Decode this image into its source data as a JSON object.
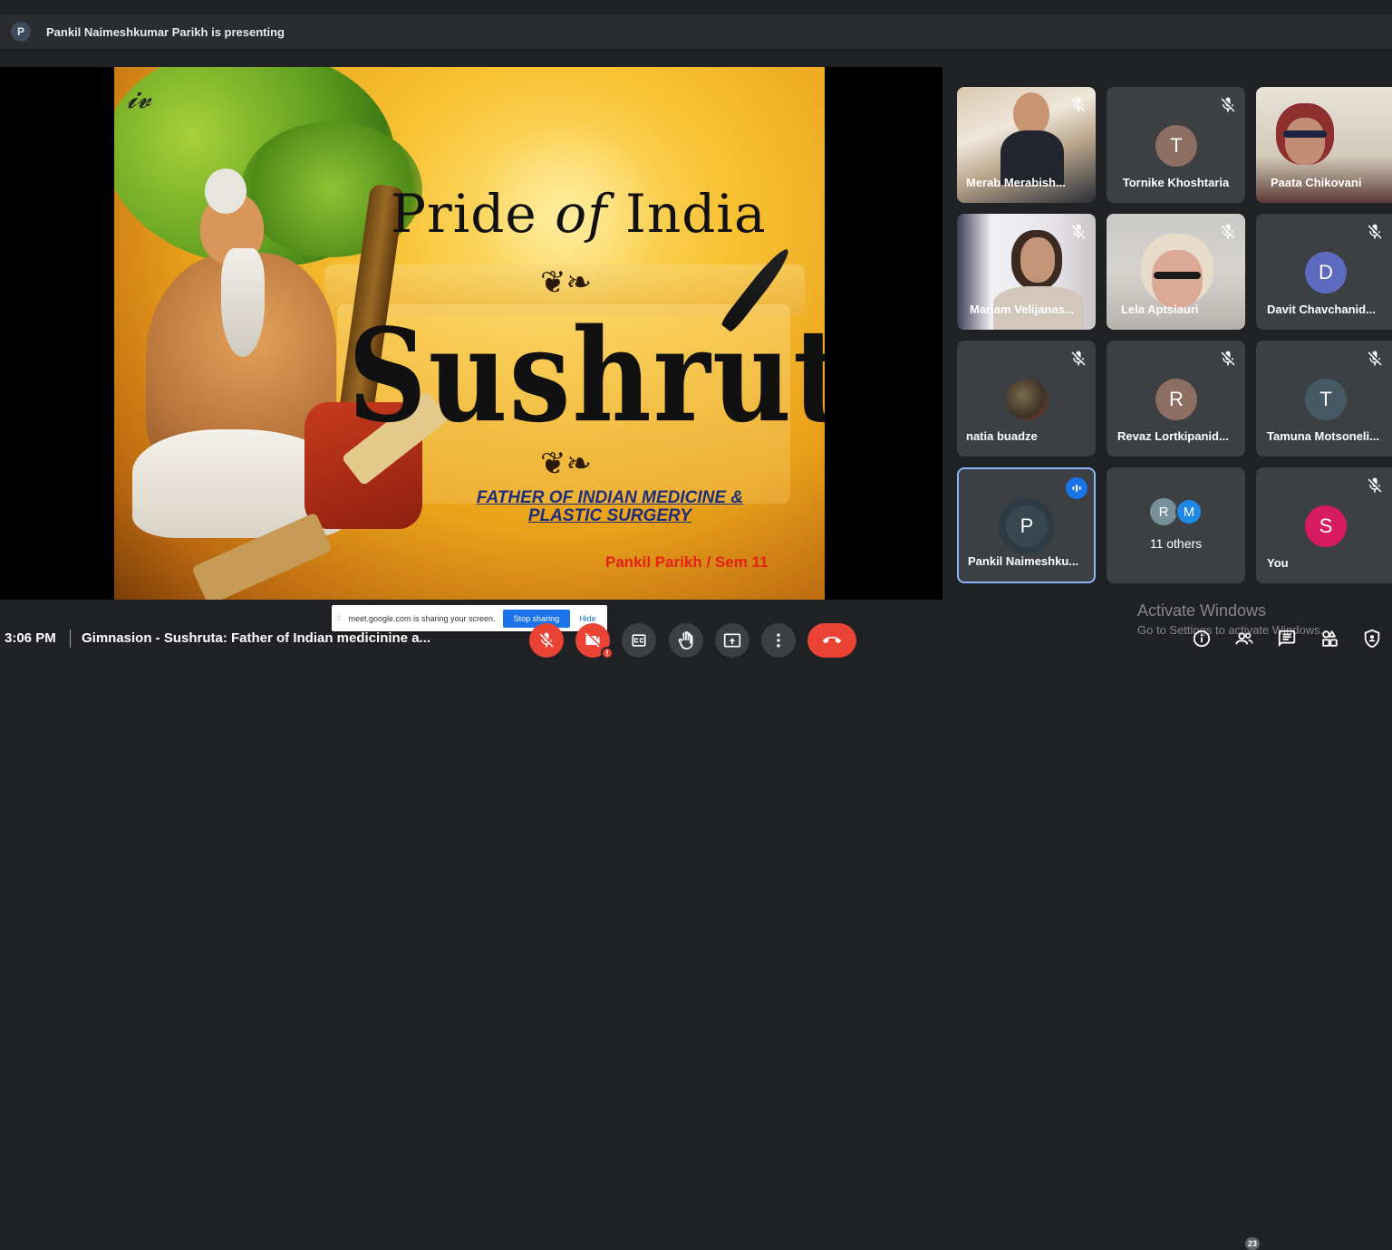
{
  "presenter_bar": {
    "avatar_letter": "P",
    "text": "Pankil Naimeshkumar Parikh is presenting"
  },
  "slide": {
    "title_prefix": "Pride",
    "title_of": "of",
    "title_suffix": "India",
    "subject": "Sushruta",
    "subtitle_line1": "FATHER OF INDIAN MEDICINE &",
    "subtitle_line2": "PLASTIC SURGERY",
    "author": "Pankil Parikh / Sem 11"
  },
  "share_notice": {
    "text": "meet.google.com is sharing your screen.",
    "stop_label": "Stop sharing",
    "hide_label": "Hide"
  },
  "participants": [
    {
      "name": "Merab Merabish...",
      "type": "video",
      "muted": true
    },
    {
      "name": "Tornike Khoshtaria",
      "type": "avatar",
      "letter": "T",
      "color": "#8d6e63",
      "muted": true
    },
    {
      "name": "Paata Chikovani",
      "type": "video",
      "muted": false
    },
    {
      "name": "Mariam Velijanas...",
      "type": "video",
      "muted": true
    },
    {
      "name": "Lela Aptsiauri",
      "type": "video",
      "muted": true
    },
    {
      "name": "Davit Chavchanid...",
      "type": "avatar",
      "letter": "D",
      "color": "#5c6bc0",
      "muted": true
    },
    {
      "name": "natia buadze",
      "type": "photo",
      "muted": true
    },
    {
      "name": "Revaz Lortkipanid...",
      "type": "avatar",
      "letter": "R",
      "color": "#8d6e63",
      "muted": true
    },
    {
      "name": "Tamuna Motsoneli...",
      "type": "avatar",
      "letter": "T",
      "color": "#455a64",
      "muted": true
    },
    {
      "name": "Pankil Naimeshku...",
      "type": "avatar",
      "letter": "P",
      "color": "#37474f",
      "speaking": true
    },
    {
      "name": "11 others",
      "type": "others",
      "letters": [
        "R",
        "M"
      ],
      "colors": [
        "#78909c",
        "#1e88e5"
      ]
    },
    {
      "name": "You",
      "type": "avatar",
      "letter": "S",
      "color": "#d81b60",
      "muted": true
    }
  ],
  "bottom_bar": {
    "time": "3:06 PM",
    "meeting_title": "Gimnasion - Sushruta: Father of Indian medicinine a...",
    "people_count": "23",
    "controls": [
      "mic-off-icon",
      "camera-off-icon",
      "captions-icon",
      "raise-hand-icon",
      "present-icon",
      "more-icon",
      "end-call-icon"
    ],
    "right_controls": [
      "info-icon",
      "people-icon",
      "chat-icon",
      "activities-icon",
      "host-controls-icon"
    ]
  },
  "watermark": {
    "line1": "Activate Windows",
    "line2": "Go to Settings to activate Windows."
  },
  "colors": {
    "background": "#202124",
    "tile": "#3c4043",
    "danger": "#ea4335",
    "accent": "#8ab4f8"
  }
}
